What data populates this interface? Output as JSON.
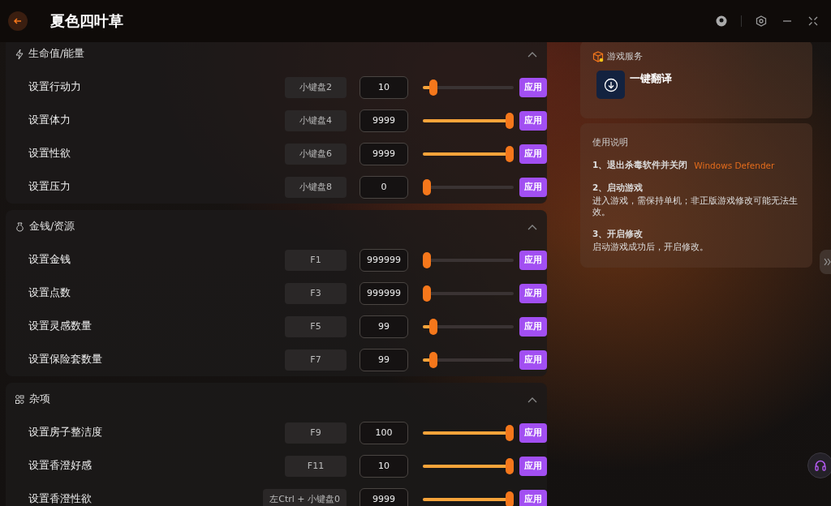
{
  "window": {
    "title": "夏色四叶草"
  },
  "sections": [
    {
      "kind": "energy",
      "title": "生命值/能量",
      "expanded": true,
      "rows": [
        {
          "label": "设置行动力",
          "hotkey": "小键盘2",
          "value": "10",
          "level": 0.08,
          "action": "应用"
        },
        {
          "label": "设置体力",
          "hotkey": "小键盘4",
          "value": "9999",
          "level": 1,
          "action": "应用"
        },
        {
          "label": "设置性欲",
          "hotkey": "小键盘6",
          "value": "9999",
          "level": 1,
          "action": "应用"
        },
        {
          "label": "设置压力",
          "hotkey": "小键盘8",
          "value": "0",
          "level": 0,
          "action": "应用"
        }
      ]
    },
    {
      "kind": "money",
      "title": "金钱/资源",
      "expanded": true,
      "rows": [
        {
          "label": "设置金钱",
          "hotkey": "F1",
          "value": "999999",
          "level": 0,
          "action": "应用"
        },
        {
          "label": "设置点数",
          "hotkey": "F3",
          "value": "999999",
          "level": 0,
          "action": "应用"
        },
        {
          "label": "设置灵感数量",
          "hotkey": "F5",
          "value": "99",
          "level": 0.08,
          "action": "应用"
        },
        {
          "label": "设置保险套数量",
          "hotkey": "F7",
          "value": "99",
          "level": 0.08,
          "action": "应用"
        }
      ]
    },
    {
      "kind": "misc",
      "title": "杂项",
      "expanded": true,
      "rows": [
        {
          "label": "设置房子整洁度",
          "hotkey": "F9",
          "value": "100",
          "level": 1,
          "action": "应用"
        },
        {
          "label": "设置香澄好感",
          "hotkey": "F11",
          "value": "10",
          "level": 1,
          "action": "应用"
        },
        {
          "label": "设置香澄性欲",
          "hotkey": "左Ctrl + 小键盘0",
          "value": "9999",
          "level": 1,
          "action": "应用"
        }
      ]
    }
  ],
  "services": {
    "title": "游戏服务",
    "items": [
      {
        "label": "一键翻译"
      }
    ]
  },
  "instructions": {
    "title": "使用说明",
    "steps": [
      {
        "heading": "1、退出杀毒软件并关闭",
        "highlight": "Windows Defender"
      },
      {
        "heading": "2、启动游戏",
        "text": "进入游戏，需保持单机；非正版游戏修改可能无法生效。"
      },
      {
        "heading": "3、开启修改",
        "text": "启动游戏成功后，开启修改。"
      }
    ]
  }
}
